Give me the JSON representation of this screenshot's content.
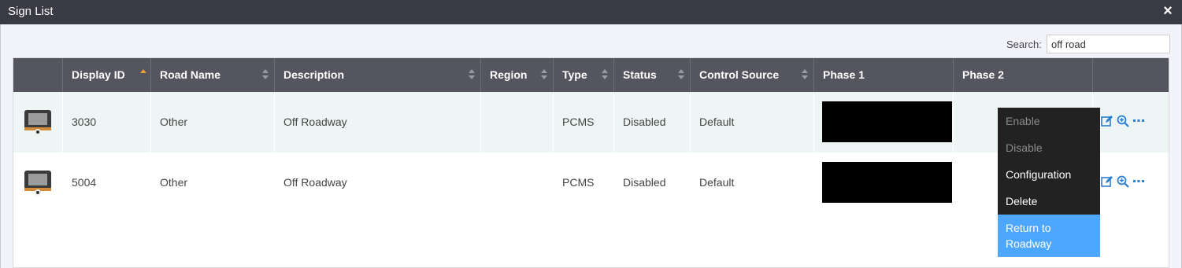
{
  "window": {
    "title": "Sign List",
    "close_icon": "×"
  },
  "search": {
    "label": "Search:",
    "value": "off road"
  },
  "table": {
    "columns": [
      {
        "label": "",
        "sort": "none"
      },
      {
        "label": "Display ID",
        "sort": "asc"
      },
      {
        "label": "Road Name",
        "sort": "both"
      },
      {
        "label": "Description",
        "sort": "both"
      },
      {
        "label": "Region",
        "sort": "both"
      },
      {
        "label": "Type",
        "sort": "both"
      },
      {
        "label": "Status",
        "sort": "both"
      },
      {
        "label": "Control Source",
        "sort": "both"
      },
      {
        "label": "Phase 1",
        "sort": "none"
      },
      {
        "label": "Phase 2",
        "sort": "none"
      },
      {
        "label": "",
        "sort": "none"
      }
    ],
    "rows": [
      {
        "display_id": "3030",
        "road_name": "Other",
        "description": "Off Roadway",
        "region": "",
        "type": "PCMS",
        "status": "Disabled",
        "control_source": "Default"
      },
      {
        "display_id": "5004",
        "road_name": "Other",
        "description": "Off Roadway",
        "region": "",
        "type": "PCMS",
        "status": "Disabled",
        "control_source": "Default"
      }
    ]
  },
  "context_menu": {
    "items": [
      {
        "label": "Enable",
        "state": "disabled"
      },
      {
        "label": "Disable",
        "state": "disabled"
      },
      {
        "label": "Configuration",
        "state": "enabled"
      },
      {
        "label": "Delete",
        "state": "enabled"
      },
      {
        "label": "Return to Roadway",
        "state": "highlighted"
      }
    ]
  },
  "colors": {
    "title_bar": "#3a3a44",
    "header_bg": "#55555f",
    "sort_active": "#f0a030",
    "row_highlight": "#eef5f5",
    "menu_bg": "#222222",
    "menu_highlight": "#4da6ff",
    "action_icon": "#2a7fd0"
  }
}
